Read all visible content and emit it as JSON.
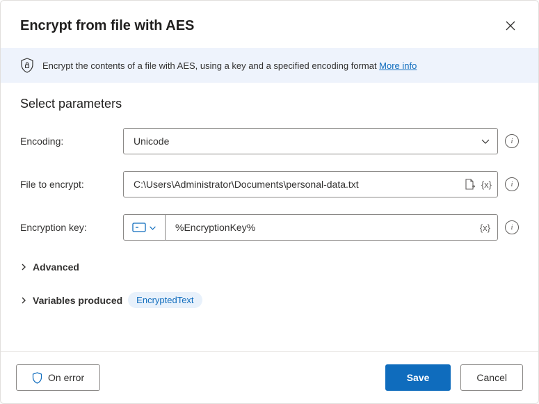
{
  "header": {
    "title": "Encrypt from file with AES"
  },
  "banner": {
    "text": "Encrypt the contents of a file with AES, using a key and a specified encoding format ",
    "link_label": "More info"
  },
  "section": {
    "title": "Select parameters"
  },
  "params": {
    "encoding": {
      "label": "Encoding:",
      "value": "Unicode"
    },
    "file": {
      "label": "File to encrypt:",
      "value": "C:\\Users\\Administrator\\Documents\\personal-data.txt"
    },
    "key": {
      "label": "Encryption key:",
      "value": "%EncryptionKey%"
    }
  },
  "advanced": {
    "label": "Advanced"
  },
  "variables": {
    "label": "Variables produced",
    "chip": "EncryptedText"
  },
  "footer": {
    "on_error": "On error",
    "save": "Save",
    "cancel": "Cancel"
  },
  "tokens": {
    "var_insert": "{x}"
  }
}
